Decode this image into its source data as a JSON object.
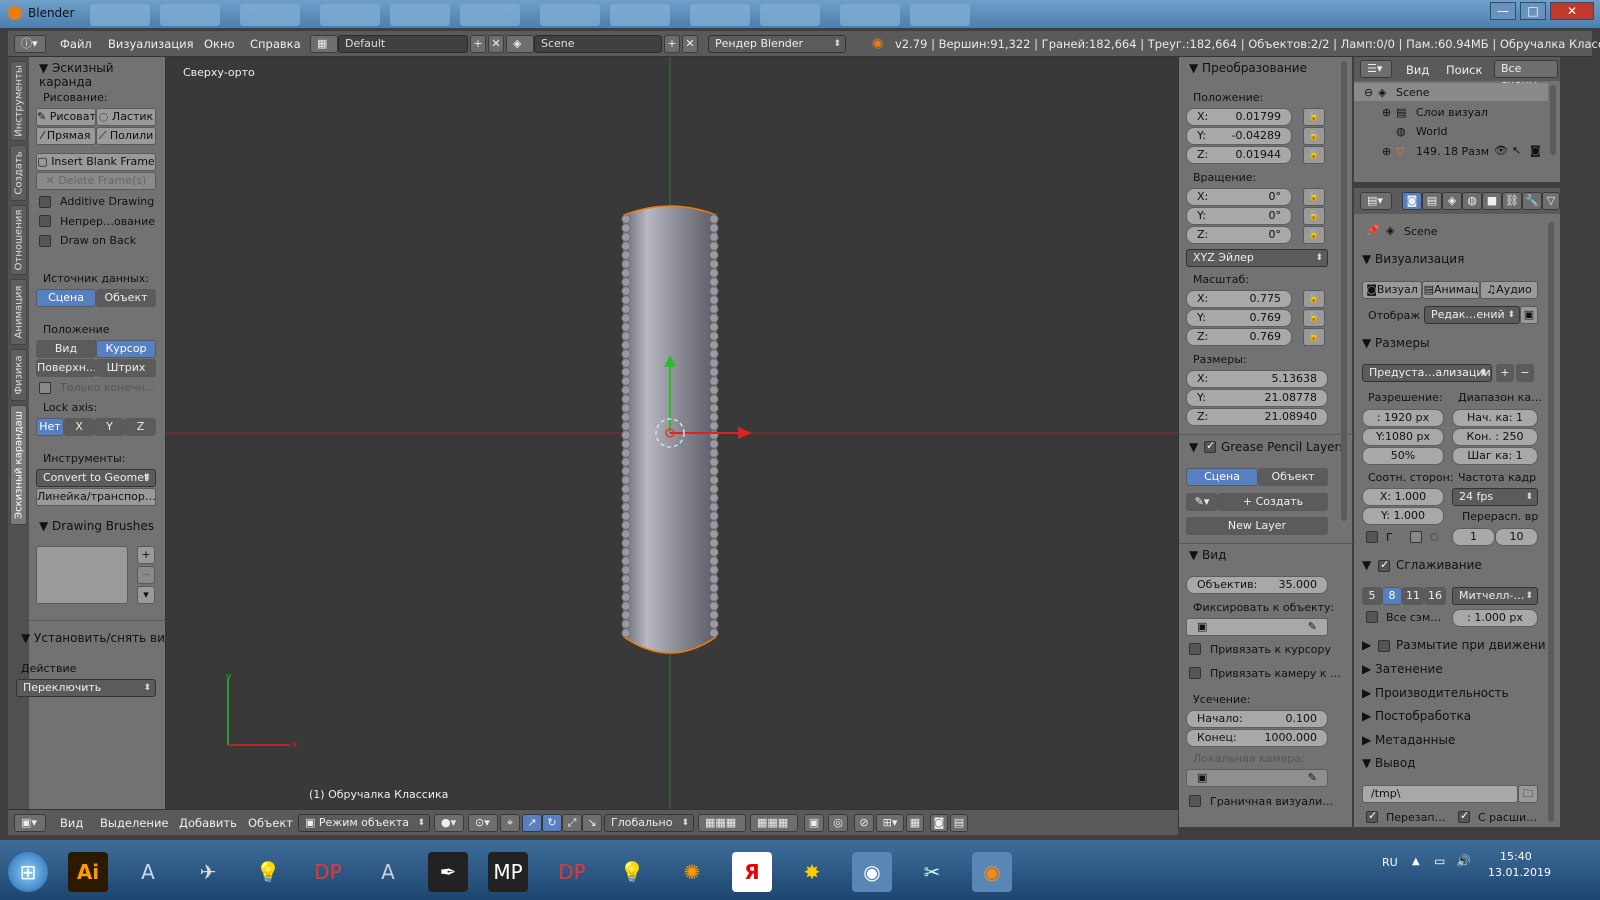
{
  "titlebar": {
    "title": "Blender"
  },
  "header": {
    "menus": [
      "Файл",
      "Визуализация",
      "Окно",
      "Справка"
    ],
    "layout": "Default",
    "scene": "Scene",
    "engine": "Рендер Blender",
    "info": "v2.79 | Вершин:91,322 | Граней:182,664 | Треуг.:182,664 | Объектов:2/2 | Ламп:0/0 | Пам.:60.94МБ | Обручалка Классика"
  },
  "tabs": [
    "Инструменты",
    "Создать",
    "Отношения",
    "Анимация",
    "Физика",
    "Эскизный карандаш"
  ],
  "shelf": {
    "panel_title": "Эскизный каранда",
    "draw_label": "Рисование:",
    "draw_btn": "Рисоват",
    "erase_btn": "Ластик",
    "line_btn": "Прямая",
    "poly_btn": "Полили",
    "insert_frame": "Insert Blank Frame",
    "delete_frames": "Delete Frame(s)",
    "additive": "Additive Drawing",
    "continuous": "Непрер…ование",
    "draw_back": "Draw on Back",
    "source_label": "Источник данных:",
    "source_scene": "Сцена",
    "source_object": "Объект",
    "stroke_label": "Положение штрихов:",
    "stroke_view": "Вид",
    "stroke_cursor": "Курсор",
    "stroke_surface": "Поверхн…",
    "stroke_stroke": "Штрих",
    "endpoints": "Только конечн…",
    "lock_label": "Lock axis:",
    "lock_none": "Нет",
    "lock_x": "X",
    "lock_y": "Y",
    "lock_z": "Z",
    "tools_label": "Инструменты:",
    "convert": "Convert to Geomet",
    "ruler": "Линейка/транспор…",
    "brushes_title": "Drawing Brushes",
    "toggle_title": "Установить/снять вид",
    "action_label": "Действие",
    "action_value": "Переключить"
  },
  "viewport": {
    "view_name": "Сверху-орто",
    "object_name": "(1) Обручалка Классика"
  },
  "npanel": {
    "transform_title": "Преобразование",
    "location_label": "Положение:",
    "loc": [
      {
        "k": "X:",
        "v": "0.01799"
      },
      {
        "k": "Y:",
        "v": "-0.04289"
      },
      {
        "k": "Z:",
        "v": "0.01944"
      }
    ],
    "rotation_label": "Вращение:",
    "rot": [
      {
        "k": "X:",
        "v": "0°"
      },
      {
        "k": "Y:",
        "v": "0°"
      },
      {
        "k": "Z:",
        "v": "0°"
      }
    ],
    "rot_mode": "XYZ Эйлер",
    "scale_label": "Масштаб:",
    "scale": [
      {
        "k": "X:",
        "v": "0.775"
      },
      {
        "k": "Y:",
        "v": "0.769"
      },
      {
        "k": "Z:",
        "v": "0.769"
      }
    ],
    "dims_label": "Размеры:",
    "dims": [
      {
        "k": "X:",
        "v": "5.13638"
      },
      {
        "k": "Y:",
        "v": "21.08778"
      },
      {
        "k": "Z:",
        "v": "21.08940"
      }
    ],
    "gp_layers_title": "Grease Pencil Layers",
    "gp_scene": "Сцена",
    "gp_object": "Объект",
    "gp_create": "Создать",
    "new_layer": "New Layer",
    "view_title": "Вид",
    "lens_k": "Объектив:",
    "lens_v": "35.000",
    "lock_object_label": "Фиксировать к объекту:",
    "lock_cursor": "Привязать к курсору",
    "lock_camera": "Привязать камеру к …",
    "clip_label": "Усечение:",
    "clip_start_k": "Начало:",
    "clip_start_v": "0.100",
    "clip_end_k": "Конец:",
    "clip_end_v": "1000.000",
    "local_camera": "Локальная камера:",
    "bounds": "Граничная визуали…"
  },
  "outliner": {
    "view_menu": "Вид",
    "search_menu": "Поиск",
    "all_scenes": "Все сцены",
    "items": [
      "Scene",
      "Слои визуал",
      "World",
      "149. 18 Разм"
    ]
  },
  "props": {
    "scene_label": "Scene",
    "render_title": "Визуализация",
    "render_btn": "Визуал",
    "anim_btn": "Анимац",
    "audio_btn": "Аудио",
    "display_label": "Отображ",
    "display_value": "Редак…ений",
    "dims_title": "Размеры",
    "preset": "Предуста…ализации",
    "res_label": "Разрешение:",
    "frame_range_label": "Диапазон ка…",
    "res_x": ": 1920 px",
    "res_y": "Y:1080 px",
    "res_pct": "50%",
    "frame_start": "Нач. ка: 1",
    "frame_end": "Кон. : 250",
    "frame_step": "Шаг ка: 1",
    "aspect_label": "Соотн. сторон:",
    "fps_label": "Частота кадр",
    "aspect_x": "X:  1.000",
    "aspect_y": "Y:  1.000",
    "fps_value": "24 fps",
    "remap_label": "Перерасп. вр",
    "border_g": "Г",
    "border_o": "О",
    "remap_old": "1",
    "remap_new": "10",
    "aa_title": "Сглаживание",
    "aa_5": "5",
    "aa_8": "8",
    "aa_11": "11",
    "aa_16": "16",
    "aa_filter": "Митчелл-…",
    "aa_full": "Все сэм…",
    "aa_size": ": 1.000 px",
    "motion_blur": "Размытие при движени",
    "shading": "Затенение",
    "performance": "Производительность",
    "postprocess": "Постобработка",
    "metadata": "Метаданные",
    "output_title": "Вывод",
    "output_path": "/tmp\\",
    "overwrite": "Перезап…",
    "extension": "С расши…"
  },
  "bottombar": {
    "menus": [
      "Вид",
      "Выделение",
      "Добавить",
      "Объект"
    ],
    "mode": "Режим объекта",
    "orientation": "Глобально"
  },
  "taskbar": {
    "lang": "RU",
    "time": "15:40",
    "date": "13.01.2019"
  },
  "colors": {
    "accent": "#5680c2",
    "panel": "#727272",
    "viewport": "#393939",
    "selection": "#e87d0d"
  }
}
